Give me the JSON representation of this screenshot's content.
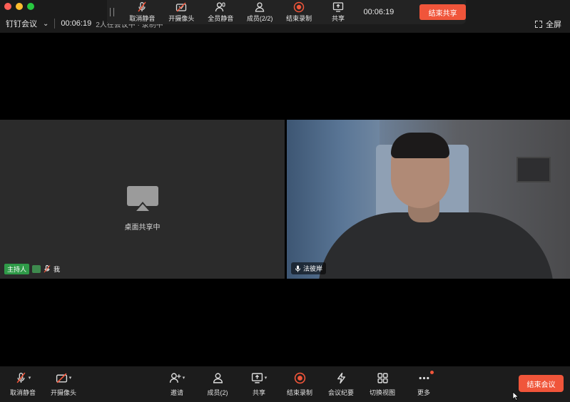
{
  "titlebar": {
    "app_title": "钉钉会议",
    "timer": "00:06:19",
    "meeting_subtitle": "2人在会议中 · 录制中",
    "fullscreen_label": "全屏"
  },
  "share_toolbar": {
    "buttons": [
      {
        "label": "取消静音",
        "icon": "mic-muted-icon"
      },
      {
        "label": "开摄像头",
        "icon": "camera-off-icon"
      },
      {
        "label": "全员静音",
        "icon": "mute-all-icon"
      },
      {
        "label": "成员(2/2)",
        "icon": "members-icon"
      },
      {
        "label": "结束录制",
        "icon": "record-stop-icon"
      },
      {
        "label": "共享",
        "icon": "share-screen-icon"
      }
    ],
    "timer": "00:06:19",
    "end_share_label": "结束共享"
  },
  "tiles": {
    "share": {
      "status_text": "桌面共享中",
      "host_badge": "主持人",
      "self_name": "我"
    },
    "camera": {
      "participant_name": "法彼岸"
    }
  },
  "bottom_toolbar": {
    "buttons": [
      {
        "label": "取消静音",
        "icon": "mic-muted-icon"
      },
      {
        "label": "开摄像头",
        "icon": "camera-off-icon"
      },
      {
        "label": "邀请",
        "icon": "invite-icon"
      },
      {
        "label": "成员(2)",
        "icon": "members-icon"
      },
      {
        "label": "共享",
        "icon": "share-screen-icon"
      },
      {
        "label": "结束录制",
        "icon": "record-stop-icon"
      },
      {
        "label": "会议纪要",
        "icon": "minutes-icon"
      },
      {
        "label": "切换视图",
        "icon": "grid-view-icon"
      },
      {
        "label": "更多",
        "icon": "more-icon"
      }
    ],
    "end_meeting_label": "结束会议"
  },
  "colors": {
    "accent_red": "#f0553a",
    "host_green": "#2f9a48",
    "toolbar_bg": "#1c1c1c",
    "tile_bg": "#2b2b2b"
  }
}
